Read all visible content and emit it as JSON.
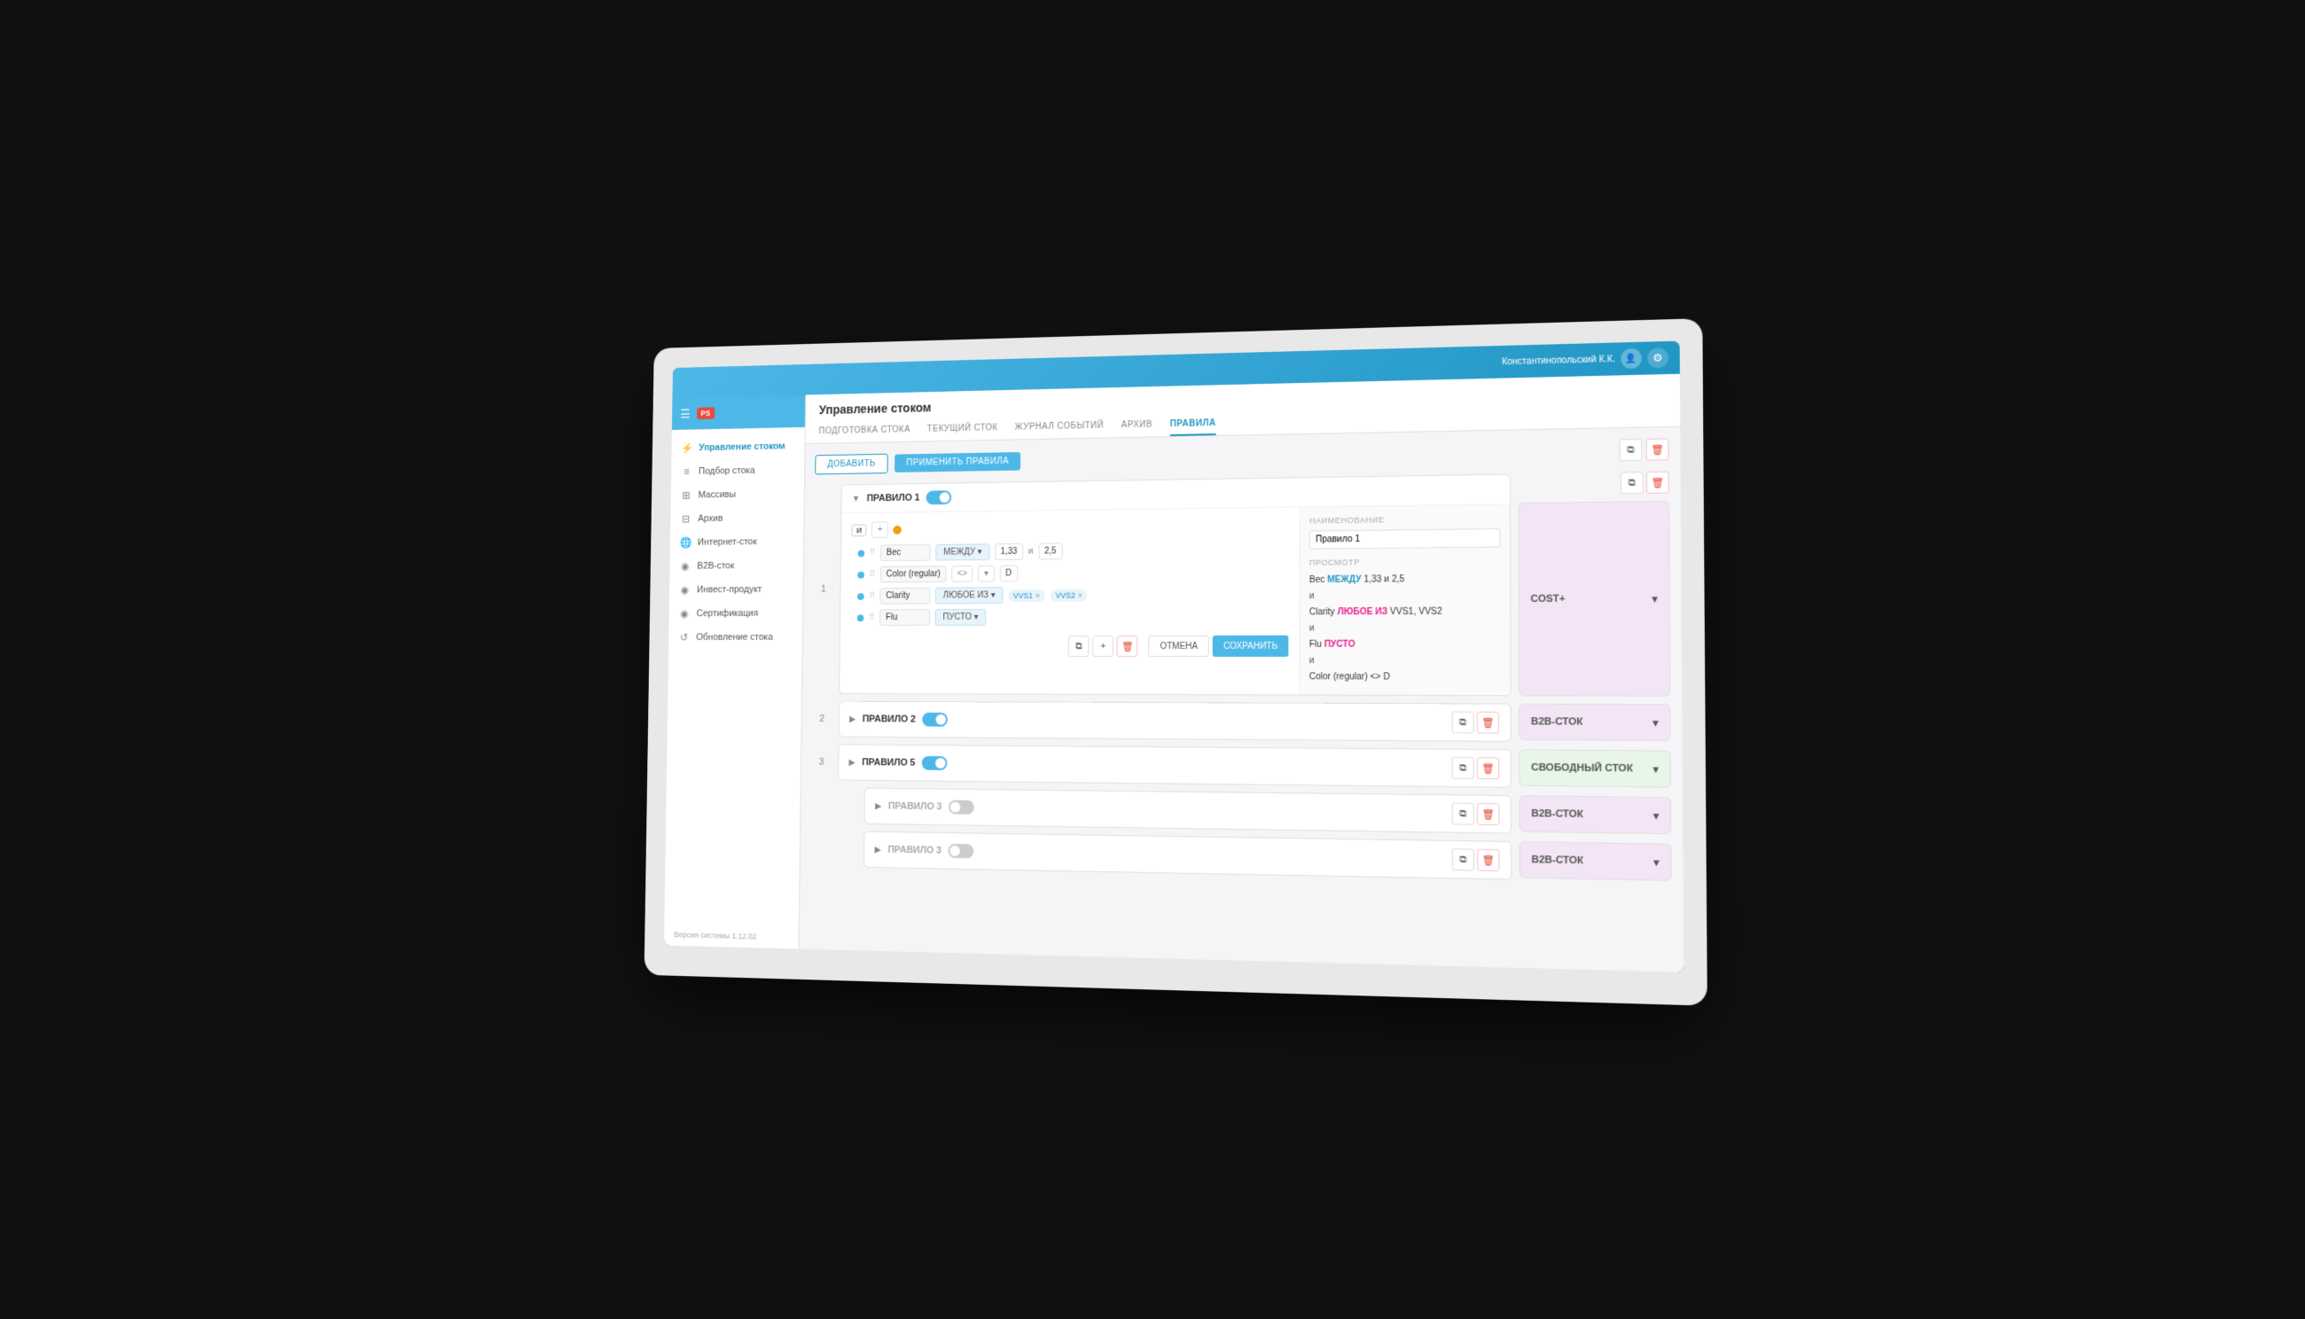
{
  "topbar": {
    "user": "Константинопольский К.К."
  },
  "sidebar": {
    "logo": "PS",
    "items": [
      {
        "id": "manage-stock",
        "label": "Управление стоком",
        "icon": "⚡",
        "active": true
      },
      {
        "id": "pick-stock",
        "label": "Подбор стока",
        "icon": "≡"
      },
      {
        "id": "massives",
        "label": "Массивы",
        "icon": "⊞"
      },
      {
        "id": "archive",
        "label": "Архив",
        "icon": "⊟"
      },
      {
        "id": "internet-stock",
        "label": "Интернет-сток",
        "icon": "🌐"
      },
      {
        "id": "b2b-stock",
        "label": "B2B-сток",
        "icon": "⊙"
      },
      {
        "id": "invest-product",
        "label": "Инвест-продукт",
        "icon": "⊙"
      },
      {
        "id": "certification",
        "label": "Сертификация",
        "icon": "⊙"
      },
      {
        "id": "update-stock",
        "label": "Обновление стока",
        "icon": "↺"
      }
    ],
    "version": "Версия системы 1.12.02"
  },
  "page": {
    "title": "Управление стоком",
    "tabs": [
      {
        "id": "prep",
        "label": "ПОДГОТОВКА СТОКА"
      },
      {
        "id": "current",
        "label": "ТЕКУЩИЙ СТОК"
      },
      {
        "id": "events",
        "label": "ЖУРНАЛ СОБЫТИЙ"
      },
      {
        "id": "archive",
        "label": "АРХИВ"
      },
      {
        "id": "rules",
        "label": "ПРАВИЛА",
        "active": true
      }
    ]
  },
  "toolbar": {
    "add_label": "ДОБАВИТЬ",
    "apply_label": "ПРИМЕНИТЬ ПРАВИЛА"
  },
  "rules": [
    {
      "number": "1",
      "name": "ПРАВИЛО 1",
      "enabled": true,
      "expanded": true,
      "result": "COST+",
      "result_style": "purple",
      "nameField": "Правило 1",
      "conditions": [
        {
          "field": "Вес",
          "operator": "МЕЖДУ",
          "values": [
            "1,33",
            "и",
            "2,5"
          ]
        },
        {
          "field": "Color (regular)",
          "operator": "<>",
          "values": [
            "D"
          ]
        },
        {
          "field": "Clarity",
          "operator": "ЛЮБОЕ ИЗ",
          "tags": [
            "VVS1",
            "VVS2"
          ]
        },
        {
          "field": "Flu",
          "operator": "ПУСТО",
          "values": []
        }
      ],
      "preview": {
        "lines": [
          {
            "text": "Вес ",
            "parts": [
              {
                "t": "Вес ",
                "c": "plain"
              },
              {
                "t": "МЕЖДУ",
                "c": "blue"
              },
              {
                "t": " 1,33 и 2,5",
                "c": "plain"
              }
            ]
          },
          {
            "text": "и",
            "parts": [
              {
                "t": "и",
                "c": "and"
              }
            ]
          },
          {
            "text": "Clarity ",
            "parts": [
              {
                "t": "Clarity ",
                "c": "plain"
              },
              {
                "t": "ЛЮБОЕ ИЗ",
                "c": "pink"
              },
              {
                "t": " VVS1, VVS2",
                "c": "plain"
              }
            ]
          },
          {
            "text": "и",
            "parts": [
              {
                "t": "и",
                "c": "and"
              }
            ]
          },
          {
            "text": "Flu ",
            "parts": [
              {
                "t": "Flu ",
                "c": "plain"
              },
              {
                "t": "ПУСТО",
                "c": "pink"
              }
            ]
          },
          {
            "text": "и",
            "parts": [
              {
                "t": "и",
                "c": "and"
              }
            ]
          },
          {
            "text": "Color (regular) <> D",
            "parts": [
              {
                "t": "Color (regular) <> D",
                "c": "plain"
              }
            ]
          }
        ]
      }
    },
    {
      "number": "2",
      "name": "ПРАВИЛО 2",
      "enabled": true,
      "expanded": false,
      "result": "B2B-СТОК",
      "result_style": "purple"
    },
    {
      "number": "3",
      "name": "ПРАВИЛО 5",
      "enabled": true,
      "expanded": false,
      "result": "СВОБОДНЫЙ СТОК",
      "result_style": "green"
    },
    {
      "number": "",
      "name": "ПРАВИЛО 3",
      "enabled": false,
      "expanded": false,
      "result": "B2B-СТОК",
      "result_style": "purple",
      "indent": true
    },
    {
      "number": "",
      "name": "ПРАВИЛО 3",
      "enabled": false,
      "expanded": false,
      "result": "B2B-СТОК",
      "result_style": "purple",
      "indent": true
    }
  ],
  "labels": {
    "and": "И",
    "cancel": "ОТМЕНА",
    "save": "СОХРАНИТЬ",
    "name_label": "НАИМЕНОВАНИЕ",
    "preview_label": "ПРОСМОТР"
  }
}
